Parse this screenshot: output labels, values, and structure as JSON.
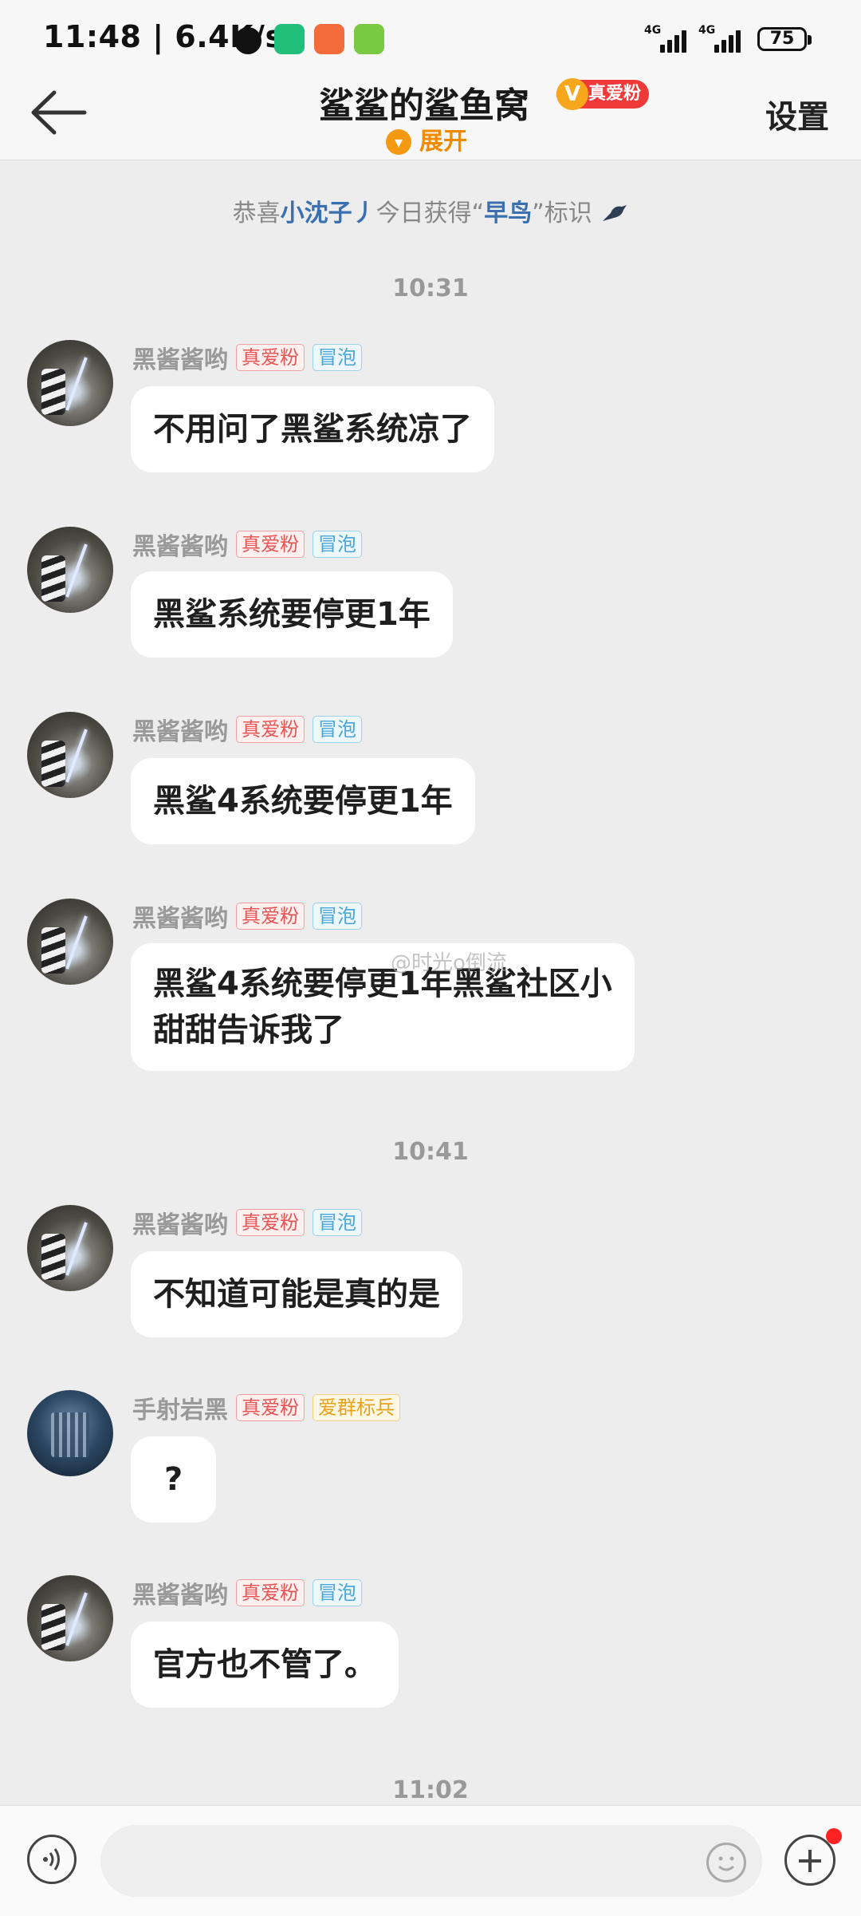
{
  "status_bar": {
    "time_speed": "11:48 | 6.4K/s",
    "network_1": "4G",
    "network_2": "4G",
    "battery": "75"
  },
  "header": {
    "title": "鲨鲨的鲨鱼窝",
    "badge_icon": "V",
    "badge": "真爱粉",
    "expand": "展开",
    "settings": "设置"
  },
  "system_notice": {
    "prefix": "恭喜",
    "user": "小沈子丿",
    "middle": "今日获得“",
    "title": "早鸟",
    "suffix": "”标识"
  },
  "timestamps": [
    "10:31",
    "10:41",
    "11:02"
  ],
  "messages": [
    {
      "sender": "黑酱酱哟",
      "tag1": "真爱粉",
      "tag2": "冒泡",
      "text": "不用问了黑鲨系统凉了"
    },
    {
      "sender": "黑酱酱哟",
      "tag1": "真爱粉",
      "tag2": "冒泡",
      "text": "黑鲨系统要停更1年"
    },
    {
      "sender": "黑酱酱哟",
      "tag1": "真爱粉",
      "tag2": "冒泡",
      "text": "黑鲨4系统要停更1年"
    },
    {
      "sender": "黑酱酱哟",
      "tag1": "真爱粉",
      "tag2": "冒泡",
      "text_line1": "黑鲨4系统要停更1年黑鲨社区小",
      "text_line2": "甜甜告诉我了"
    },
    {
      "sender": "黑酱酱哟",
      "tag1": "真爱粉",
      "tag2": "冒泡",
      "text": "不知道可能是真的是"
    },
    {
      "sender": "手射岩黑",
      "tag1": "真爱粉",
      "tag2": "爱群标兵",
      "text": "?"
    },
    {
      "sender": "黑酱酱哟",
      "tag1": "真爱粉",
      "tag2": "冒泡",
      "text": "官方也不管了。"
    }
  ],
  "watermark": "@时光o倒流",
  "input": {
    "placeholder": ""
  },
  "colors": {
    "background": "#ededed",
    "accent_orange": "#f08a00",
    "badge_red": "#f03a3a",
    "link_blue": "#3a6fb0"
  }
}
